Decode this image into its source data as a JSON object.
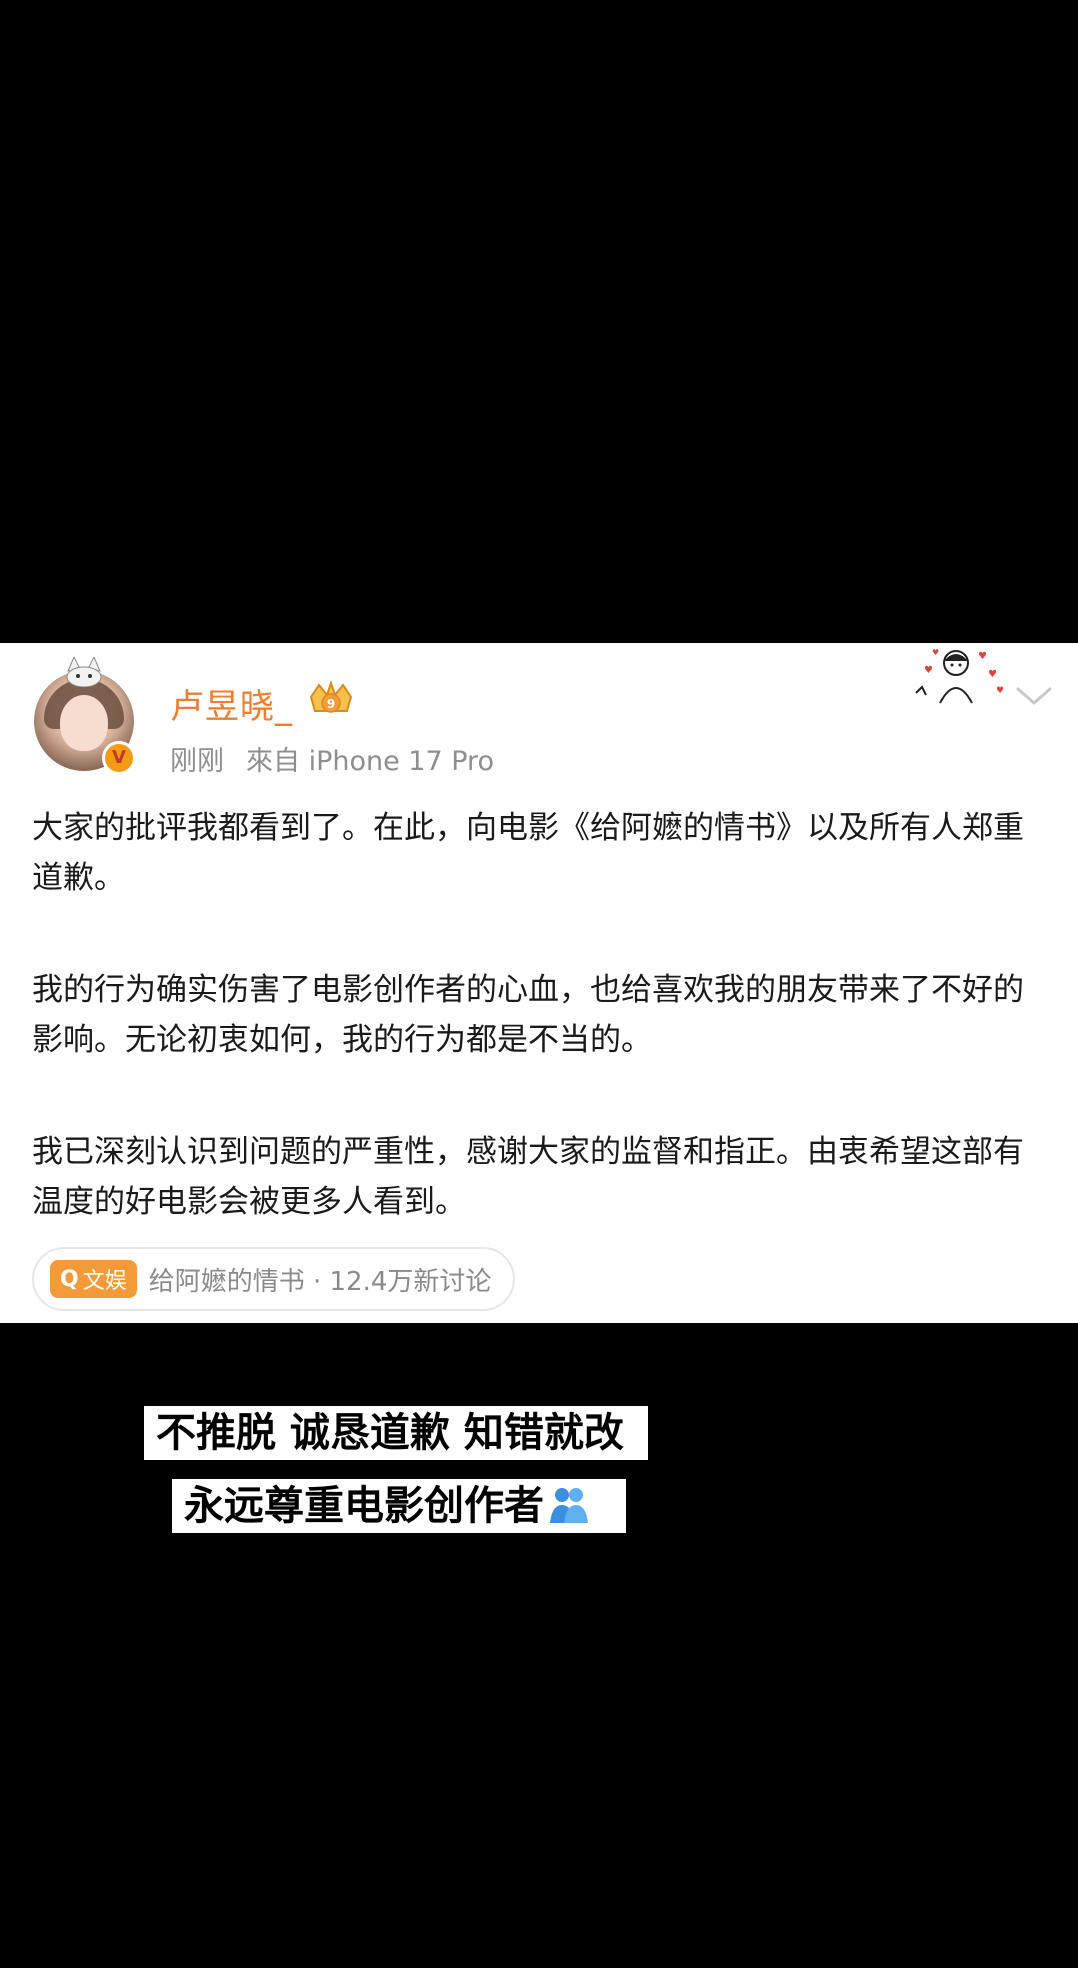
{
  "post": {
    "username": "卢昱晓_",
    "time": "刚刚",
    "source": "來自 iPhone 17 Pro",
    "paragraphs": [
      "大家的批评我都看到了。在此，向电影《给阿嬷的情书》以及所有人郑重道歉。",
      "我的行为确实伤害了电影创作者的心血，也给喜欢我的朋友带来了不好的影响。无论初衷如何，我的行为都是不当的。",
      "我已深刻认识到问题的严重性，感谢大家的监督和指正。由衷希望这部有温度的好电影会被更多人看到。"
    ],
    "topic": {
      "tag": "文娱",
      "text": "给阿嬷的情书 · 12.4万新讨论"
    },
    "icons": {
      "verified": "verified-v-icon",
      "vip": "crown-vip-icon",
      "menu": "chevron-down-icon",
      "tag": "search-icon"
    }
  },
  "captions": {
    "line1": "不推脱 诚恳道歉 知错就改",
    "line2": "永远尊重电影创作者",
    "line2_emoji": "hugging-people-icon"
  },
  "colors": {
    "username": "#ef7d2b",
    "tag_bg": "#f39b38",
    "background": "#000000",
    "card": "#ffffff"
  }
}
